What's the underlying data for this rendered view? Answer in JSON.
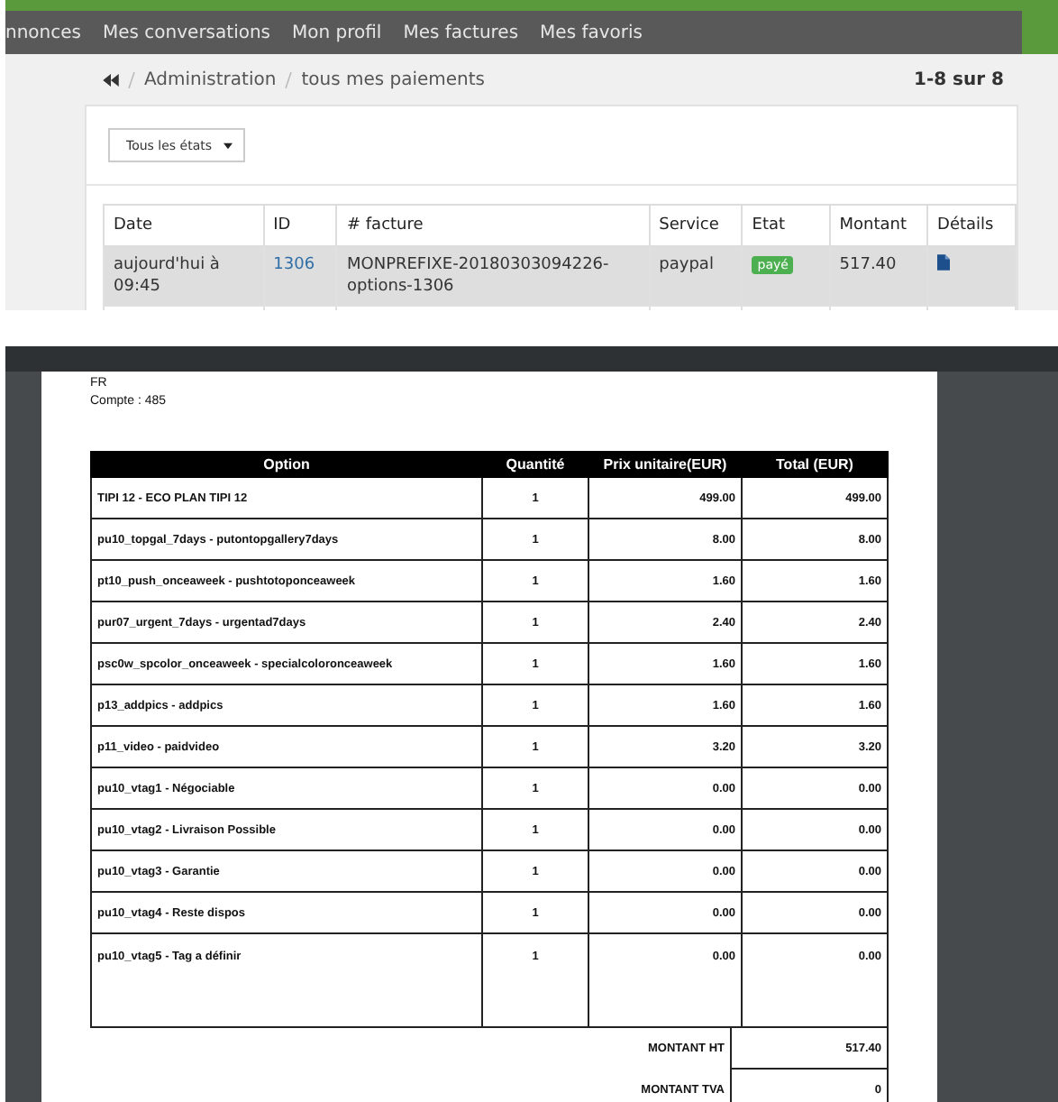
{
  "nav": {
    "items": [
      "nnonces",
      "Mes conversations",
      "Mon profil",
      "Mes factures",
      "Mes favoris"
    ]
  },
  "breadcrumb": [
    "Administration",
    "tous mes paiements"
  ],
  "pagination": "1-8 sur 8",
  "filter": {
    "value": "Tous les états"
  },
  "payments": {
    "columns": [
      "Date",
      "ID",
      "# facture",
      "Service",
      "Etat",
      "Montant",
      "Détails"
    ],
    "rows": [
      {
        "date": "aujourd'hui à 09:45",
        "id": "1306",
        "invoice": "MONPREFIXE-20180303094226-options-1306",
        "service": "paypal",
        "status": "payé",
        "amount": "517.40"
      }
    ]
  },
  "pdf": {
    "address": [
      "FR",
      "Compte : 485"
    ],
    "columns": [
      "Option",
      "Quantité",
      "Prix unitaire(EUR)",
      "Total (EUR)"
    ],
    "rows": [
      [
        "TIPI 12 - ECO PLAN TIPI 12",
        "1",
        "499.00",
        "499.00"
      ],
      [
        "pu10_topgal_7days - putontopgallery7days",
        "1",
        "8.00",
        "8.00"
      ],
      [
        "pt10_push_onceaweek - pushtotoponceaweek",
        "1",
        "1.60",
        "1.60"
      ],
      [
        "pur07_urgent_7days - urgentad7days",
        "1",
        "2.40",
        "2.40"
      ],
      [
        "psc0w_spcolor_onceaweek - specialcoloronceaweek",
        "1",
        "1.60",
        "1.60"
      ],
      [
        "p13_addpics - addpics",
        "1",
        "1.60",
        "1.60"
      ],
      [
        "p11_video - paidvideo",
        "1",
        "3.20",
        "3.20"
      ],
      [
        "pu10_vtag1 - Négociable",
        "1",
        "0.00",
        "0.00"
      ],
      [
        "pu10_vtag2 - Livraison Possible",
        "1",
        "0.00",
        "0.00"
      ],
      [
        "pu10_vtag3 - Garantie",
        "1",
        "0.00",
        "0.00"
      ],
      [
        "pu10_vtag4 - Reste dispos",
        "1",
        "0.00",
        "0.00"
      ],
      [
        "pu10_vtag5 - Tag a définir",
        "1",
        "0.00",
        "0.00"
      ]
    ],
    "totals": [
      {
        "label": "MONTANT HT",
        "value": "517.40"
      },
      {
        "label": "MONTANT TVA",
        "value": "0"
      }
    ]
  }
}
